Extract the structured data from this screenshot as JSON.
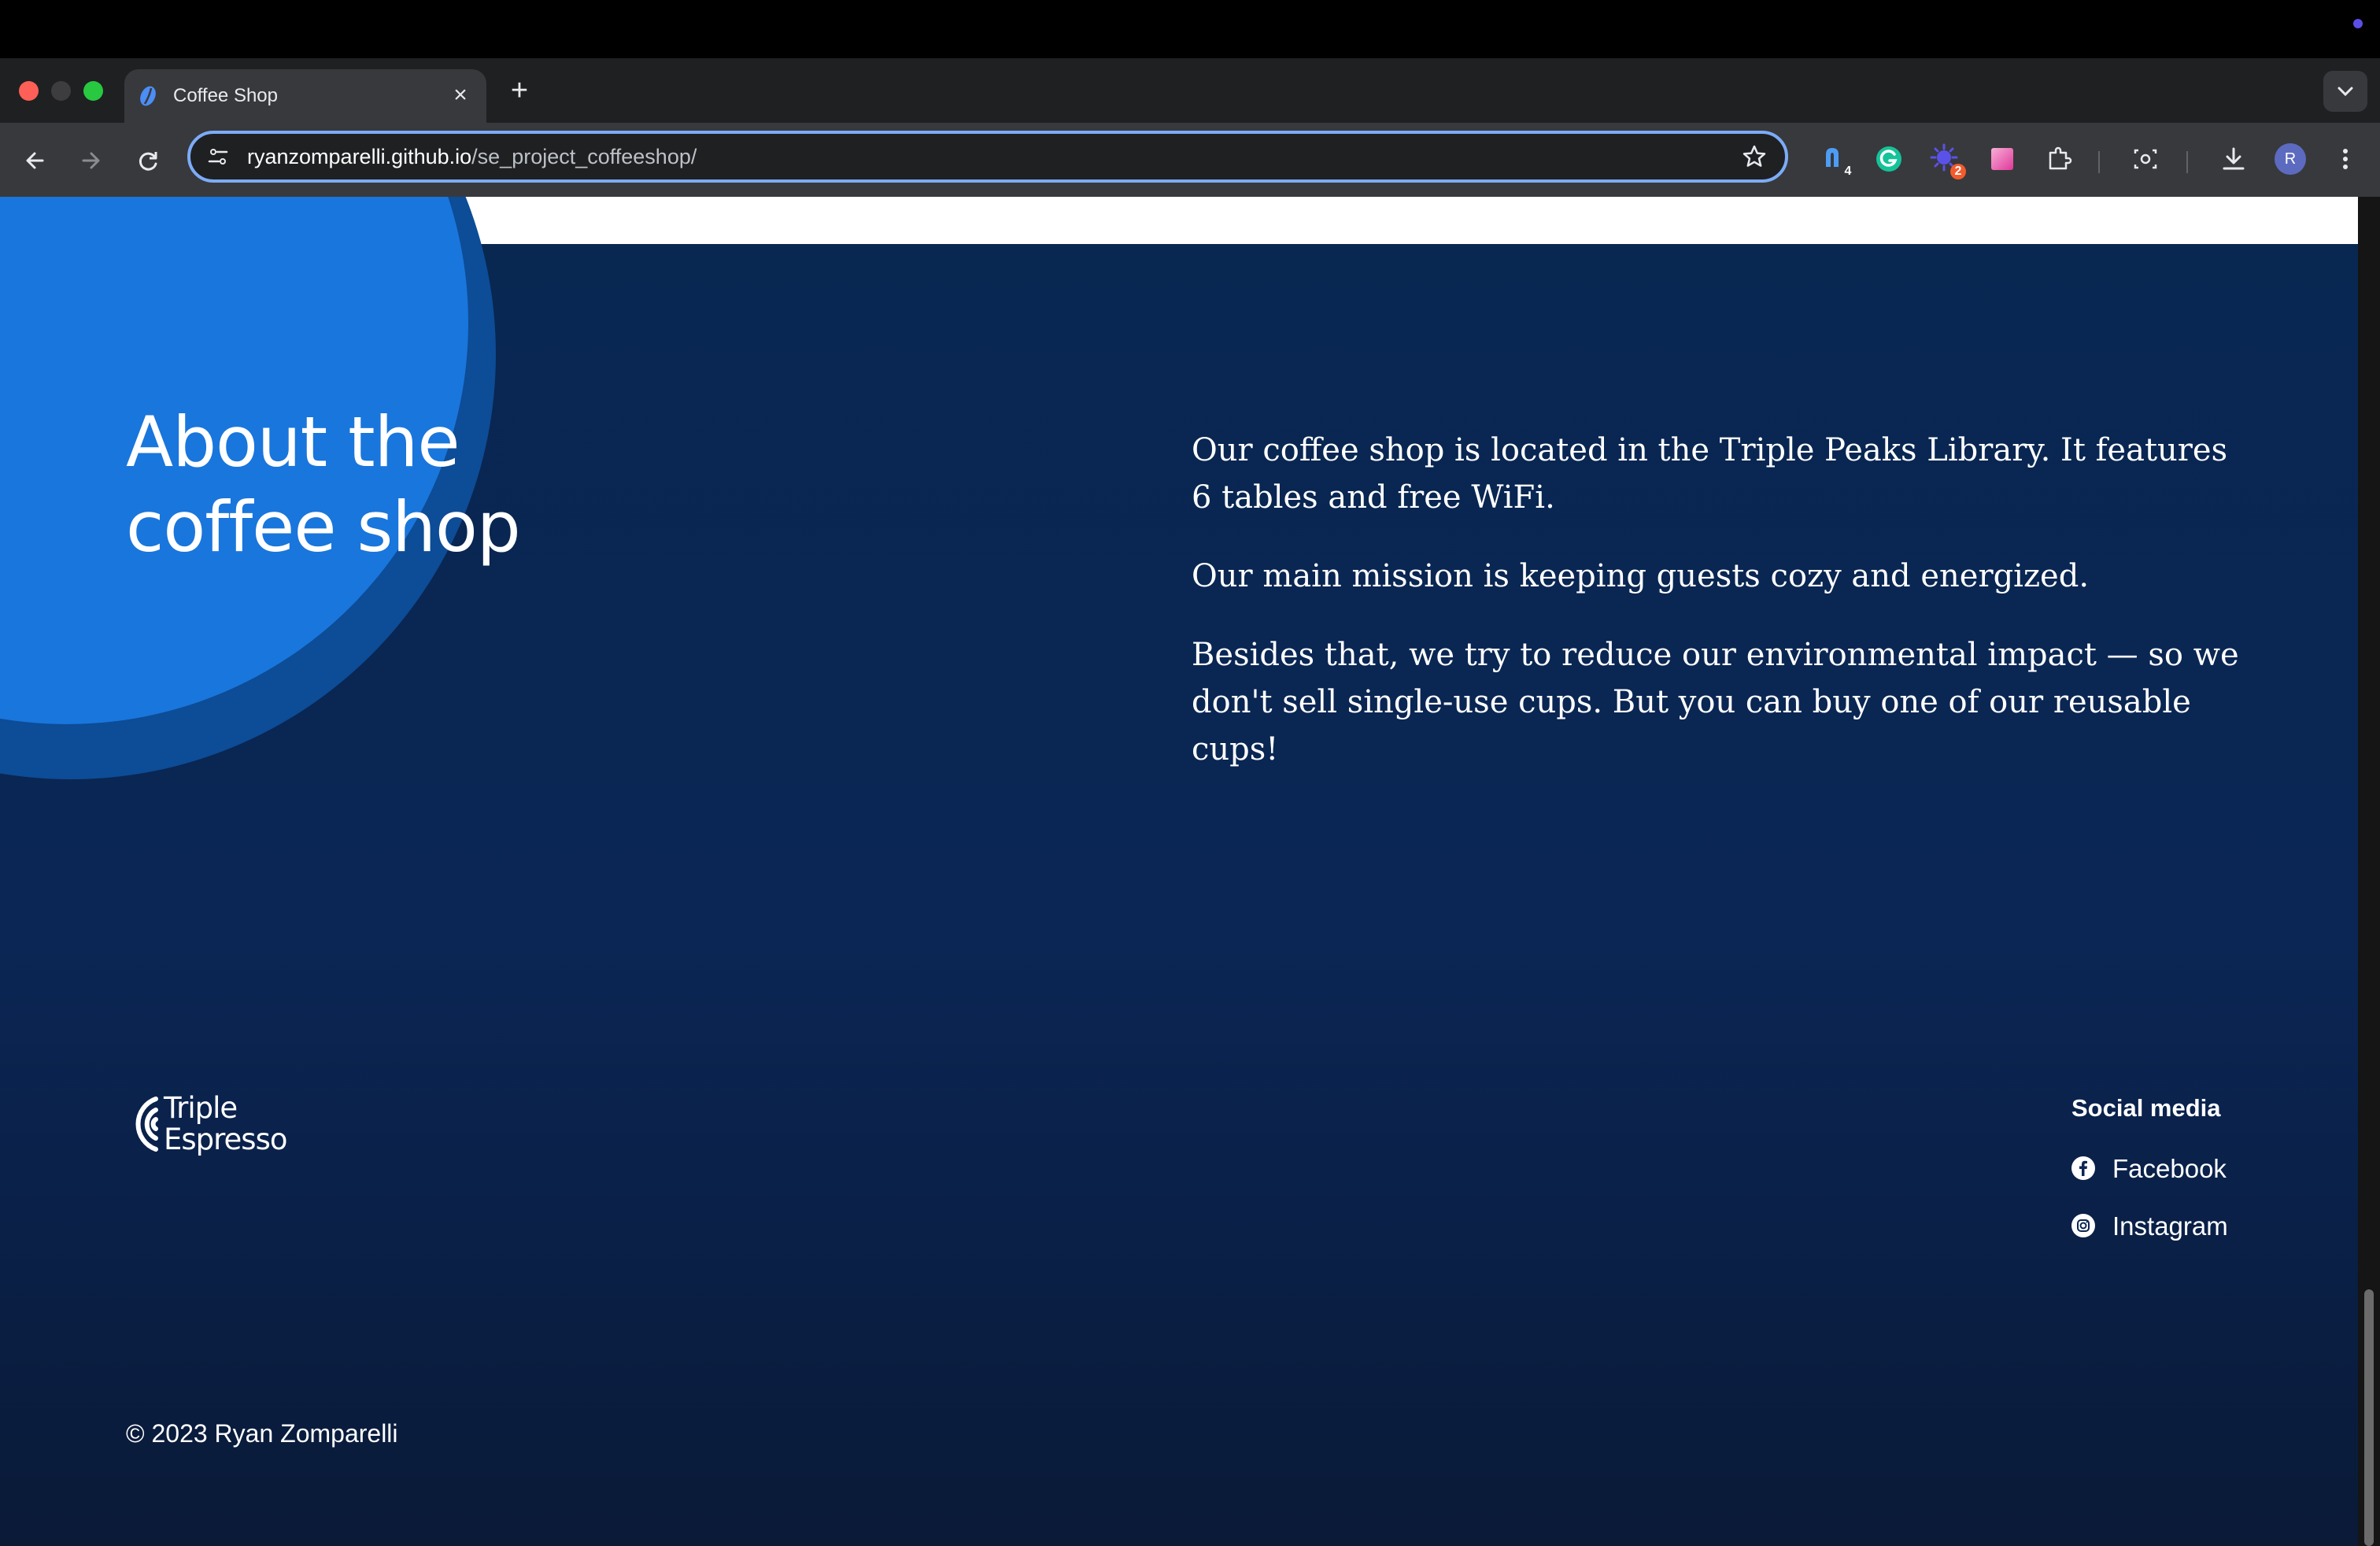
{
  "browser": {
    "tab": {
      "title": "Coffee Shop",
      "close_label": "×"
    },
    "new_tab_label": "+",
    "omnibox": {
      "host": "ryanzomparelli.github.io",
      "path": "/se_project_coffeeshop/"
    },
    "extensions": [
      {
        "name": "extension-1",
        "badge": "4",
        "badge_color": "#ffffff"
      },
      {
        "name": "grammarly",
        "badge": ""
      },
      {
        "name": "extension-3",
        "badge": "2",
        "badge_color": "#f35b2c"
      },
      {
        "name": "extension-4",
        "badge": ""
      }
    ],
    "avatar_initial": "R",
    "accent_color": "#7cacf8"
  },
  "page": {
    "about": {
      "title": "About the coffee shop",
      "paragraphs": [
        "Our coffee shop is located in the Triple Peaks Library. It features 6 tables and free WiFi.",
        "Our main mission is keeping guests cozy and energized.",
        "Besides that, we try to reduce our environmental impact — so we don't sell single-use cups. But you can buy one of our reusable cups!"
      ]
    },
    "footer": {
      "logo_line1": "Triple",
      "logo_line2": "Espresso",
      "social_heading": "Social media",
      "social_links": [
        {
          "label": "Facebook",
          "icon": "facebook-icon"
        },
        {
          "label": "Instagram",
          "icon": "instagram-icon"
        }
      ],
      "copyright": "© 2023 Ryan Zomparelli"
    },
    "colors": {
      "background": "#082751",
      "circle_inner": "#1976dc",
      "circle_outer": "#0d4c96",
      "text": "#ffffff"
    }
  }
}
